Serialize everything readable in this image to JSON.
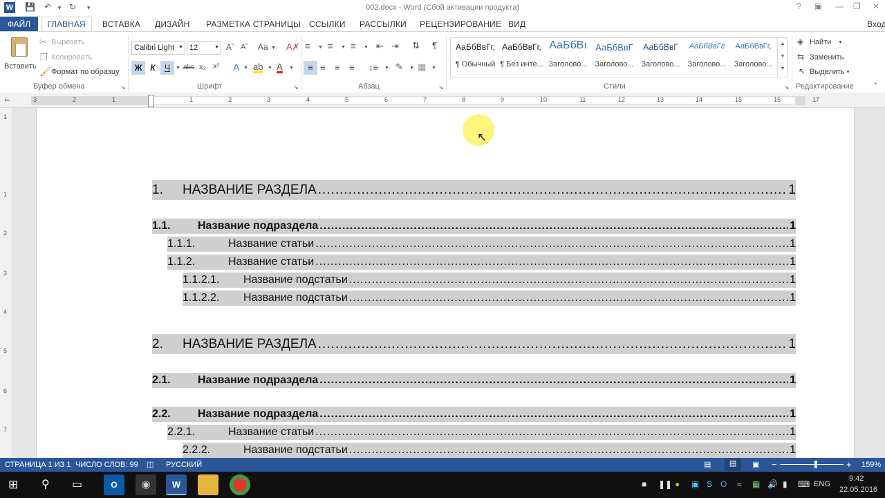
{
  "window": {
    "title": "002.docx - Word (Сбой активации продукта)",
    "login": "Вход"
  },
  "tabs": {
    "file": "ФАЙЛ",
    "home": "ГЛАВНАЯ",
    "insert": "ВСТАВКА",
    "design": "ДИЗАЙН",
    "layout": "РАЗМЕТКА СТРАНИЦЫ",
    "refs": "ССЫЛКИ",
    "mail": "РАССЫЛКИ",
    "review": "РЕЦЕНЗИРОВАНИЕ",
    "view": "ВИД"
  },
  "clipboard": {
    "paste": "Вставить",
    "cut": "Вырезать",
    "copy": "Копировать",
    "format_painter": "Формат по образцу",
    "label": "Буфер обмена"
  },
  "font": {
    "name": "Calibri Light",
    "size": "12",
    "label": "Шрифт",
    "bold": "Ж",
    "italic": "К",
    "underline": "Ч",
    "strike": "abc",
    "change_case": "Aa"
  },
  "paragraph": {
    "label": "Абзац"
  },
  "styles": {
    "label": "Стили",
    "items": [
      {
        "preview": "АаБбВвГг,",
        "name": "¶ Обычный"
      },
      {
        "preview": "АаБбВвГг,",
        "name": "¶ Без инте..."
      },
      {
        "preview": "АаБбВı",
        "name": "Заголово..."
      },
      {
        "preview": "АаБбВвГ",
        "name": "Заголово..."
      },
      {
        "preview": "АаБбВвГ",
        "name": "Заголово..."
      },
      {
        "preview": "АаБбВвГг",
        "name": "Заголово..."
      },
      {
        "preview": "АаБбВвГг,",
        "name": "Заголово..."
      }
    ]
  },
  "editing": {
    "find": "Найти",
    "replace": "Заменить",
    "select": "Выделить",
    "label": "Редактирование"
  },
  "ruler_numbers": [
    "3",
    "2",
    "1",
    "1",
    "2",
    "3",
    "4",
    "5",
    "6",
    "7",
    "8",
    "9",
    "10",
    "11",
    "12",
    "13",
    "14",
    "15",
    "16",
    "17"
  ],
  "vruler_numbers": [
    "1",
    "1",
    "2",
    "3",
    "4",
    "5",
    "6",
    "7"
  ],
  "toc": [
    {
      "level": 1,
      "num": "1.",
      "text": "НАЗВАНИЕ РАЗДЕЛА",
      "page": "1"
    },
    {
      "level": 2,
      "num": "1.1.",
      "text": "Название подраздела",
      "page": "1"
    },
    {
      "level": 3,
      "num": "1.1.1.",
      "text": "Название статьи",
      "page": "1"
    },
    {
      "level": 3,
      "num": "1.1.2.",
      "text": "Название статьи",
      "page": "1"
    },
    {
      "level": 4,
      "num": "1.1.2.1.",
      "text": "Название подстатьи",
      "page": "1"
    },
    {
      "level": 4,
      "num": "1.1.2.2.",
      "text": "Название подстатьи",
      "page": "1"
    },
    {
      "level": 1,
      "num": "2.",
      "text": "НАЗВАНИЕ РАЗДЕЛА",
      "page": "1"
    },
    {
      "level": 2,
      "num": "2.1.",
      "text": "Название подраздела",
      "page": "1"
    },
    {
      "level": 2,
      "num": "2.2.",
      "text": "Название подраздела",
      "page": "1"
    },
    {
      "level": 3,
      "num": "2.2.1.",
      "text": "Название статьи",
      "page": "1"
    },
    {
      "level": 4,
      "num": "2.2.2.",
      "text": "Название подстатьи",
      "page": "1"
    }
  ],
  "status": {
    "page": "СТРАНИЦА 1 ИЗ 1",
    "words": "ЧИСЛО СЛОВ: 99",
    "lang": "РУССКИЙ",
    "zoom": "159%"
  },
  "taskbar": {
    "lang": "ENG",
    "time": "9:42",
    "date": "22.05.2016"
  },
  "colors": {
    "accent": "#2b579a",
    "toc_highlight": "#cfcfcf"
  }
}
